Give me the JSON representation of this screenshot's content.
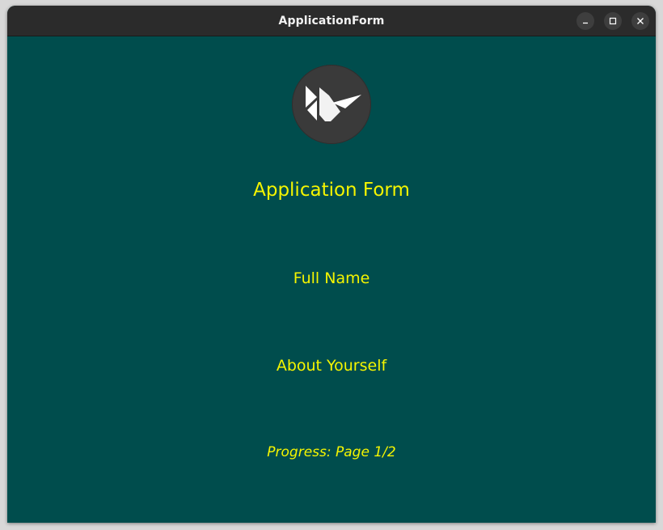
{
  "window": {
    "title": "ApplicationForm",
    "controls": {
      "minimize_icon": "minimize-icon",
      "maximize_icon": "maximize-icon",
      "close_icon": "close-icon"
    }
  },
  "form": {
    "logo_icon": "kivy-logo-icon",
    "title": "Application Form",
    "full_name_label": "Full Name",
    "about_label": "About Yourself",
    "progress_text": "Progress: Page 1/2"
  },
  "colors": {
    "background": "#004d4d",
    "text": "#f5f500",
    "titlebar": "#2b2b2b",
    "logo_circle": "#3a3a3a"
  }
}
